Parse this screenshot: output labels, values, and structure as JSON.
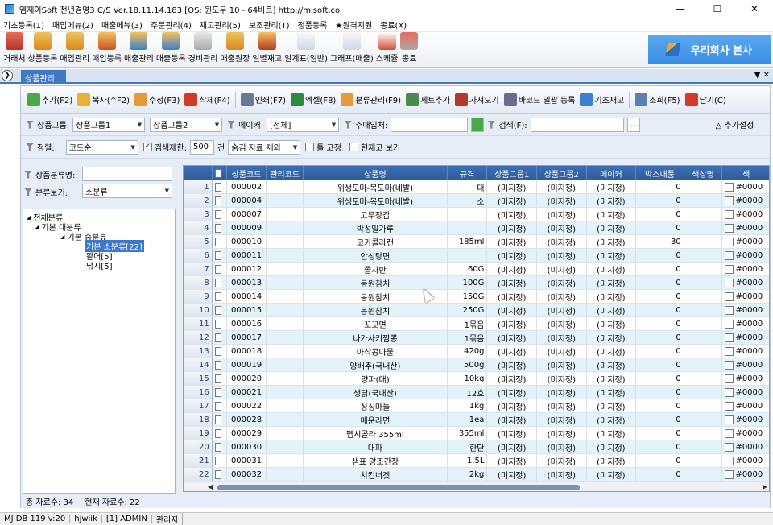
{
  "window": {
    "title": "엠제이Soft 천년경영3 C/S  Ver.18.11.14.183  [OS: 윈도우 10 - 64비트]  http://mjsoft.co"
  },
  "menu": [
    "기초등록(1)",
    "매입메뉴(2)",
    "매출메뉴(3)",
    "주문관리(4)",
    "재고관리(5)",
    "보조관리(T)",
    "정품등록",
    "★원격지원",
    "종료(X)"
  ],
  "toolbar": [
    "거래처",
    "상품등록",
    "매입관리",
    "매입등록",
    "매출관리",
    "매출등록",
    "경비관리",
    "매출원장",
    "일별재고",
    "일계표(일반)",
    "그래프(매출)",
    "스케쥴",
    "종료"
  ],
  "company": "우리회사 본사",
  "tab": {
    "label": "상품관리"
  },
  "ctool": [
    "추가(F2)",
    "복사(^F2)",
    "수정(F3)",
    "삭제(F4)",
    "인쇄(F7)",
    "엑셀(F8)",
    "분류관리(F9)",
    "세트추가",
    "가져오기",
    "바코드 일괄 등록",
    "기초재고",
    "조회(F5)",
    "닫기(C)"
  ],
  "filters": {
    "group_label": "상품그룹:",
    "group1": "상품그룹1",
    "group2": "상품그룹2",
    "maker_label": "메이커:",
    "maker": "[전체]",
    "supplier_label": "주매입처:",
    "search_label": "검색(F):",
    "more": "추가설정",
    "sort_label": "정렬:",
    "sort": "코드순",
    "limit_label": "검색제한:",
    "limit": "500",
    "limit_unit": "건",
    "hide": "숨김 자료 제외",
    "fix": "틀 고정",
    "stock": "현재고 보기"
  },
  "left": {
    "name_label": "상품분류명:",
    "view_label": "분류보기:",
    "view": "소분류",
    "tree": [
      "전체분류",
      "기본 대분류",
      "기본 중분류",
      "기본 소분류[22]",
      "활어[5]",
      "낚시[5]"
    ]
  },
  "grid": {
    "columns": [
      "",
      "상품코드",
      "관리코드",
      "상품명",
      "규격",
      "상품그룹1",
      "상품그룹2",
      "메이커",
      "박스내품",
      "색상명",
      "색"
    ],
    "rows": [
      [
        "1",
        "000002",
        "",
        "위생도마-목도마(네발)",
        "대",
        "(미지정)",
        "(미지정)",
        "(미지정)",
        "0",
        "",
        "#0000"
      ],
      [
        "2",
        "000004",
        "",
        "위생도마-목도마(네발)",
        "소",
        "(미지정)",
        "(미지정)",
        "(미지정)",
        "0",
        "",
        "#0000"
      ],
      [
        "3",
        "000007",
        "",
        "고무장갑",
        "",
        "(미지정)",
        "(미지정)",
        "(미지정)",
        "0",
        "",
        "#0000"
      ],
      [
        "4",
        "000009",
        "",
        "박성밀가루",
        "",
        "(미지정)",
        "(미지정)",
        "(미지정)",
        "0",
        "",
        "#0000"
      ],
      [
        "5",
        "000010",
        "",
        "코카콜라캔",
        "185ml",
        "(미지정)",
        "(미지정)",
        "(미지정)",
        "30",
        "",
        "#0000"
      ],
      [
        "6",
        "000011",
        "",
        "안성탕면",
        "",
        "(미지정)",
        "(미지정)",
        "(미지정)",
        "0",
        "",
        "#0000"
      ],
      [
        "7",
        "000012",
        "",
        "졸자반",
        "60G",
        "(미지정)",
        "(미지정)",
        "(미지정)",
        "0",
        "",
        "#0000"
      ],
      [
        "8",
        "000013",
        "",
        "동원참치",
        "100G",
        "(미지정)",
        "(미지정)",
        "(미지정)",
        "0",
        "",
        "#0000"
      ],
      [
        "9",
        "000014",
        "",
        "동원참치",
        "150G",
        "(미지정)",
        "(미지정)",
        "(미지정)",
        "0",
        "",
        "#0000"
      ],
      [
        "10",
        "000015",
        "",
        "동원참치",
        "250G",
        "(미지정)",
        "(미지정)",
        "(미지정)",
        "0",
        "",
        "#0000"
      ],
      [
        "11",
        "000016",
        "",
        "꼬꼬면",
        "1묶음",
        "(미지정)",
        "(미지정)",
        "(미지정)",
        "0",
        "",
        "#0000"
      ],
      [
        "12",
        "000017",
        "",
        "나가사키짬뽕",
        "1묶음",
        "(미지정)",
        "(미지정)",
        "(미지정)",
        "0",
        "",
        "#0000"
      ],
      [
        "13",
        "000018",
        "",
        "아삭콩나물",
        "420g",
        "(미지정)",
        "(미지정)",
        "(미지정)",
        "0",
        "",
        "#0000"
      ],
      [
        "14",
        "000019",
        "",
        "양배추(국내산)",
        "500g",
        "(미지정)",
        "(미지정)",
        "(미지정)",
        "0",
        "",
        "#0000"
      ],
      [
        "15",
        "000020",
        "",
        "양파(대)",
        "10kg",
        "(미지정)",
        "(미지정)",
        "(미지정)",
        "0",
        "",
        "#0000"
      ],
      [
        "16",
        "000021",
        "",
        "생닭(국내산)",
        "12호",
        "(미지정)",
        "(미지정)",
        "(미지정)",
        "0",
        "",
        "#0000"
      ],
      [
        "17",
        "000022",
        "",
        "싱싱마늘",
        "1kg",
        "(미지정)",
        "(미지정)",
        "(미지정)",
        "0",
        "",
        "#0000"
      ],
      [
        "18",
        "000028",
        "",
        "매운라면",
        "1ea",
        "(미지정)",
        "(미지정)",
        "(미지정)",
        "0",
        "",
        "#0000"
      ],
      [
        "19",
        "000029",
        "",
        "펩시콜라 355ml",
        "355ml",
        "(미지정)",
        "(미지정)",
        "(미지정)",
        "0",
        "",
        "#0000"
      ],
      [
        "20",
        "000030",
        "",
        "대파",
        "한단",
        "(미지정)",
        "(미지정)",
        "(미지정)",
        "0",
        "",
        "#0000"
      ],
      [
        "21",
        "000031",
        "",
        "샘표 양조간장",
        "1.5L",
        "(미지정)",
        "(미지정)",
        "(미지정)",
        "0",
        "",
        "#0000"
      ],
      [
        "22",
        "000032",
        "",
        "치킨너겟",
        "2kg",
        "(미지정)",
        "(미지정)",
        "(미지정)",
        "0",
        "",
        "#0000"
      ]
    ]
  },
  "cstatus": {
    "total": "총 자료수: 34",
    "current": "현재 자료수: 22"
  },
  "status": [
    "MJ DB 119 v:20",
    "hjwiik",
    "[1] ADMIN",
    "관리자"
  ]
}
